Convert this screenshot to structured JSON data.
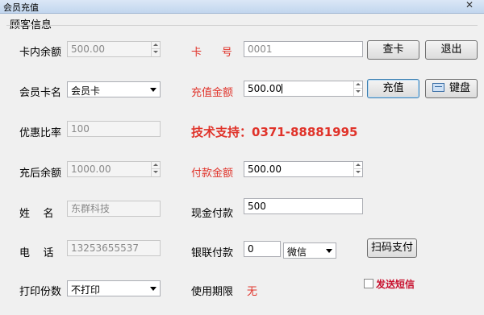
{
  "window": {
    "title": "会员充值",
    "close_glyph": "✕"
  },
  "group": {
    "label": "顾客信息"
  },
  "left": {
    "card_balance_label": "卡内余额",
    "card_balance_value": "500.00",
    "card_name_label": "会员卡名",
    "card_name_value": "会员卡",
    "discount_label": "优惠比率",
    "discount_value": "100",
    "after_balance_label": "充后余额",
    "after_balance_value": "1000.00",
    "name_label": "姓    名",
    "name_value": "东群科技",
    "phone_label": "电    话",
    "phone_value": "13253655537",
    "print_label": "打印份数",
    "print_value": "不打印"
  },
  "right": {
    "card_no_label": "卡      号",
    "card_no_value": "0001",
    "recharge_label": "充值金额",
    "recharge_value": "500.00",
    "support_text": "技术支持：0371-88881995",
    "pay_label": "付款金额",
    "pay_value": "500.00",
    "cash_label": "现金付款",
    "cash_value": "500",
    "union_label": "银联付款",
    "union_value": "0",
    "wechat_value": "微信",
    "expiry_label": "使用期限",
    "expiry_value": "无",
    "sms_label": "发送短信"
  },
  "buttons": {
    "query": "查卡",
    "exit": "退出",
    "recharge": "充值",
    "keyboard": "键盘",
    "scan_pay": "扫码支付"
  },
  "colors": {
    "accent_red": "#e0332a",
    "sms_red": "#c8102e"
  }
}
